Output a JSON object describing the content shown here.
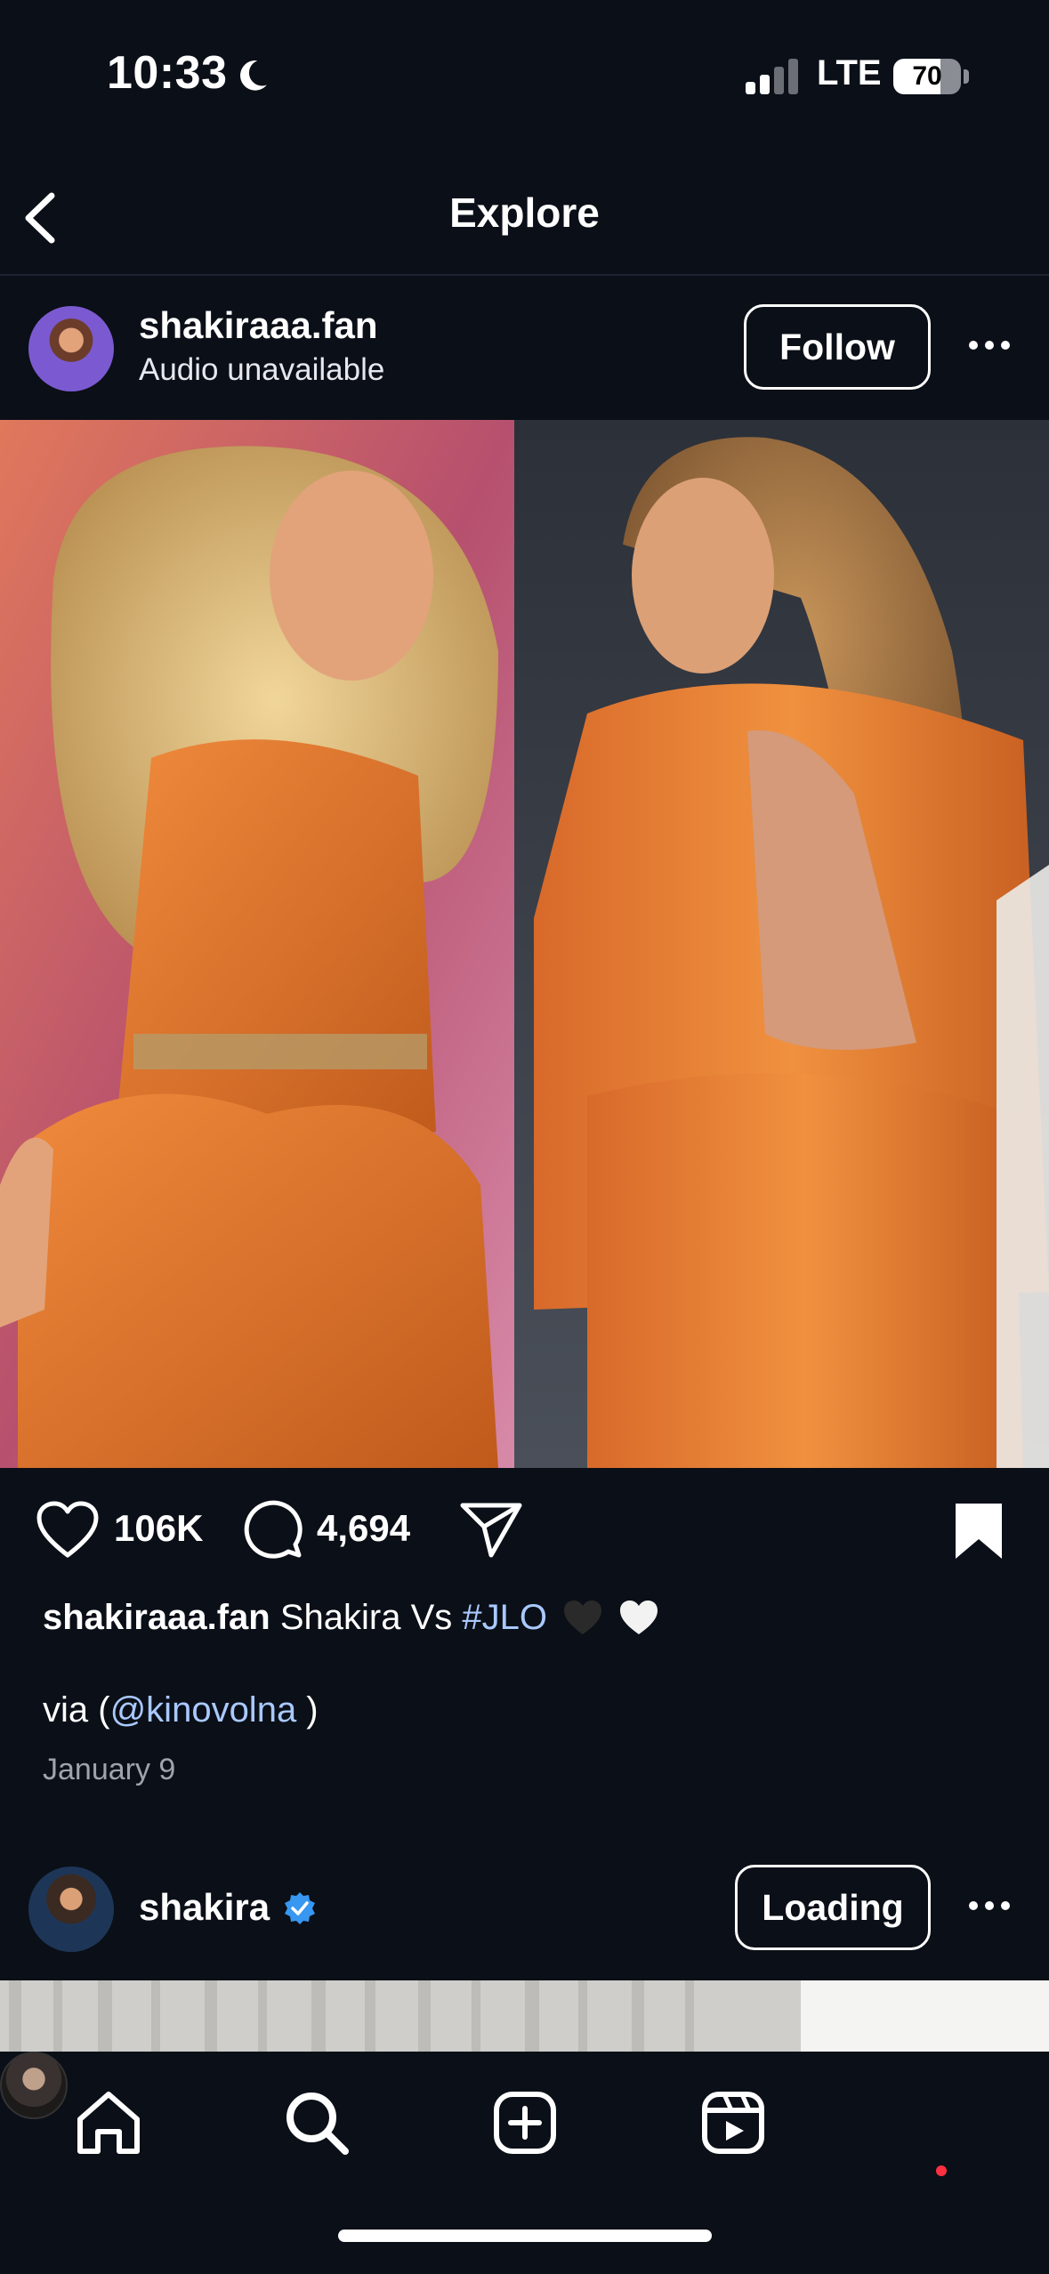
{
  "status_bar": {
    "time": "10:33",
    "network": "LTE",
    "battery_percent": 70
  },
  "header": {
    "title": "Explore"
  },
  "post": {
    "username": "shakiraaa.fan",
    "audio_label": "Audio unavailable",
    "follow_label": "Follow",
    "likes": "106K",
    "comments": "4,694",
    "caption": {
      "username": "shakiraaa.fan",
      "text": "Shakira Vs",
      "hashtag": "#JLO",
      "via_prefix": "via (",
      "mention": "@kinovolna",
      "via_suffix": " )"
    },
    "date": "January 9"
  },
  "next_post": {
    "username": "shakira",
    "follow_label": "Loading"
  },
  "colors": {
    "background": "#0b0f17",
    "link": "#a9c9ff",
    "verified": "#3897f0",
    "notification": "#ff3040"
  },
  "icons": {
    "back": "chevron-left-icon",
    "more": "ellipsis-icon",
    "like": "heart-icon",
    "comment": "comment-bubble-icon",
    "share": "paper-plane-icon",
    "save": "bookmark-icon",
    "home": "home-icon",
    "search": "search-icon",
    "create": "plus-square-icon",
    "reels": "reels-icon"
  }
}
